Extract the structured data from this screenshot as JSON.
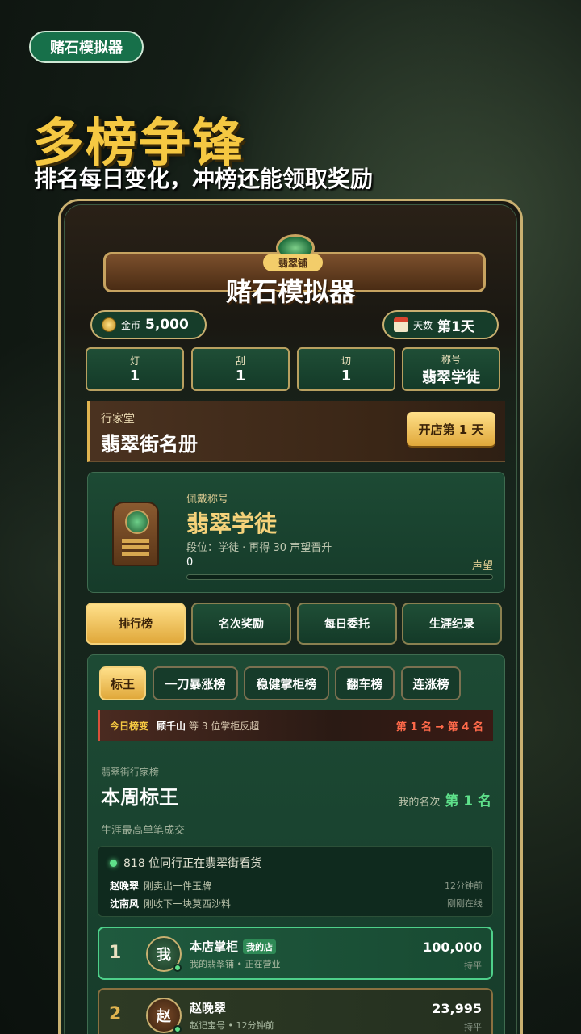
{
  "badge": "赌石模拟器",
  "hero": {
    "title": "多榜争锋",
    "subtitle": "排名每日变化，冲榜还能领取奖励"
  },
  "app": {
    "shop_tag": "翡翠铺",
    "title": "赌石模拟器",
    "gold_label": "金币",
    "gold_value": "5,000",
    "day_label": "天数",
    "day_value": "第1天",
    "stats": [
      {
        "label": "灯",
        "value": "1"
      },
      {
        "label": "刮",
        "value": "1"
      },
      {
        "label": "切",
        "value": "1"
      },
      {
        "label": "称号",
        "value": "翡翠学徒"
      }
    ],
    "hall": {
      "label": "行家堂",
      "name": "翡翠街名册",
      "button": "开店第 1 天"
    },
    "title_card": {
      "label": "佩戴称号",
      "name": "翡翠学徒",
      "desc": "段位：学徒 · 再得 30 声望晋升",
      "progress_value": "0",
      "progress_label": "声望",
      "progress_fraction": 0
    },
    "tabs": [
      "排行榜",
      "名次奖励",
      "每日委托",
      "生涯纪录"
    ],
    "board": {
      "chips": [
        "标王",
        "一刀暴涨榜",
        "稳健掌柜榜",
        "翻车榜",
        "连涨榜"
      ],
      "change": {
        "label": "今日榜变",
        "who": "顾千山",
        "rest": "等 3 位掌柜反超",
        "move": "第 1 名 → 第 4 名"
      },
      "section_label": "翡翠街行家榜",
      "section_title": "本周标王",
      "my_rank_label": "我的名次",
      "my_rank_value": "第 1 名",
      "section_desc": "生涯最高单笔成交",
      "activity": {
        "head": "818 位同行正在翡翠街看货",
        "rows": [
          {
            "name": "赵晚翠",
            "text": "刚卖出一件玉牌",
            "time": "12分钟前"
          },
          {
            "name": "沈南风",
            "text": "刚收下一块莫西沙料",
            "time": "刚刚在线"
          }
        ]
      },
      "rows": [
        {
          "rank": "1",
          "avatar": "我",
          "name": "本店掌柜",
          "tag": "我的店",
          "sub": "我的翡翠铺 • 正在营业",
          "score": "100,000",
          "trend": "持平"
        },
        {
          "rank": "2",
          "avatar": "赵",
          "name": "赵晚翠",
          "tag": "",
          "sub": "赵记宝号 • 12分钟前",
          "score": "23,995",
          "trend": "持平"
        }
      ]
    }
  }
}
